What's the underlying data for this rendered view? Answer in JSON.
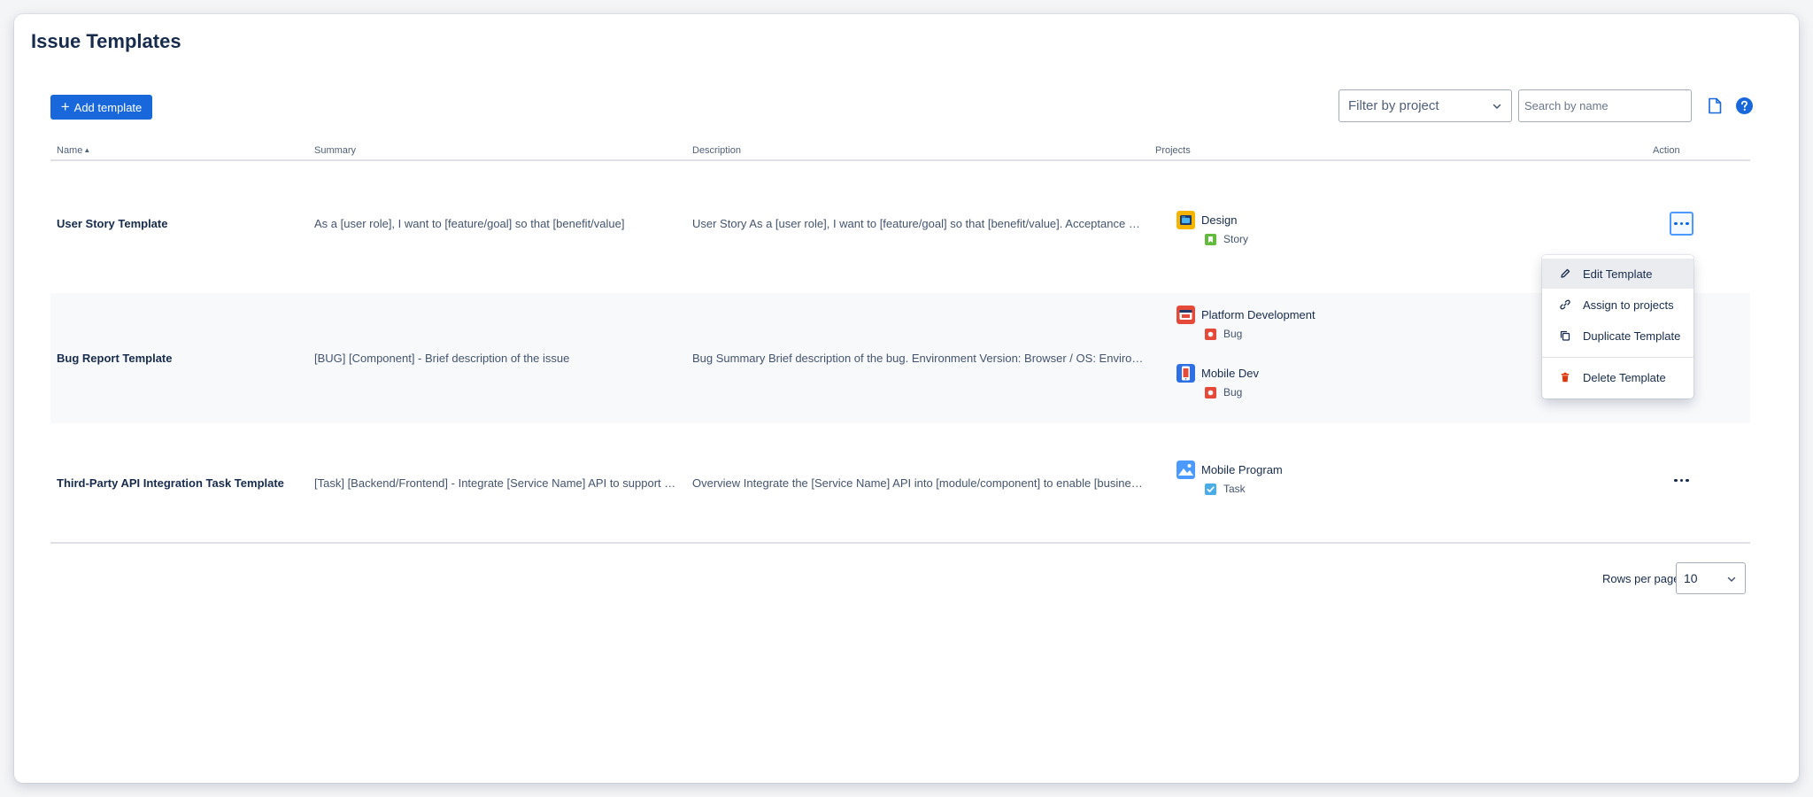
{
  "page": {
    "title": "Issue Templates"
  },
  "toolbar": {
    "add_label": "Add template",
    "filter_placeholder": "Filter by project",
    "search_placeholder": "Search by name"
  },
  "table": {
    "columns": {
      "name": "Name",
      "summary": "Summary",
      "description": "Description",
      "projects": "Projects",
      "action": "Action"
    },
    "rows": [
      {
        "name": "User Story Template",
        "summary": "As a [user role], I want to [feature/goal] so that [benefit/value]",
        "description": "User Story As a [user role], I want to [feature/goal] so that [benefit/value]. Acceptance Criteria",
        "projects": [
          {
            "name": "Design",
            "type": "Story",
            "avatar_icon": "design-project-icon",
            "type_icon": "story-icon"
          }
        ]
      },
      {
        "name": "Bug Report Template",
        "summary": "[BUG] [Component] - Brief description of the issue",
        "description": "Bug Summary Brief description of the bug. Environment Version: Browser / OS: Environment",
        "projects": [
          {
            "name": "Platform Development",
            "type": "Bug",
            "avatar_icon": "platform-project-icon",
            "type_icon": "bug-icon"
          },
          {
            "name": "Mobile Dev",
            "type": "Bug",
            "avatar_icon": "mobile-project-icon",
            "type_icon": "bug-icon"
          }
        ]
      },
      {
        "name": "Third-Party API Integration Task Template",
        "summary": "[Task] [Backend/Frontend] - Integrate [Service Name] API to support feature",
        "description": "Overview Integrate the [Service Name] API into [module/component] to enable [business value]",
        "projects": [
          {
            "name": "Mobile Program",
            "type": "Task",
            "avatar_icon": "mobile-program-project-icon",
            "type_icon": "task-icon"
          }
        ]
      }
    ]
  },
  "action_menu": {
    "items": [
      {
        "label": "Edit Template",
        "icon": "pencil-icon"
      },
      {
        "label": "Assign to projects",
        "icon": "link-icon"
      },
      {
        "label": "Duplicate Template",
        "icon": "copy-icon"
      },
      {
        "label": "Delete Template",
        "icon": "trash-icon"
      }
    ]
  },
  "pagination": {
    "rows_per_page_label": "Rows per page:",
    "rows_per_page_value": "10"
  },
  "colors": {
    "primary": "#1868db",
    "story": "#63ba3c",
    "bug": "#e5493a",
    "task": "#4bade8",
    "delete": "#de350b"
  }
}
